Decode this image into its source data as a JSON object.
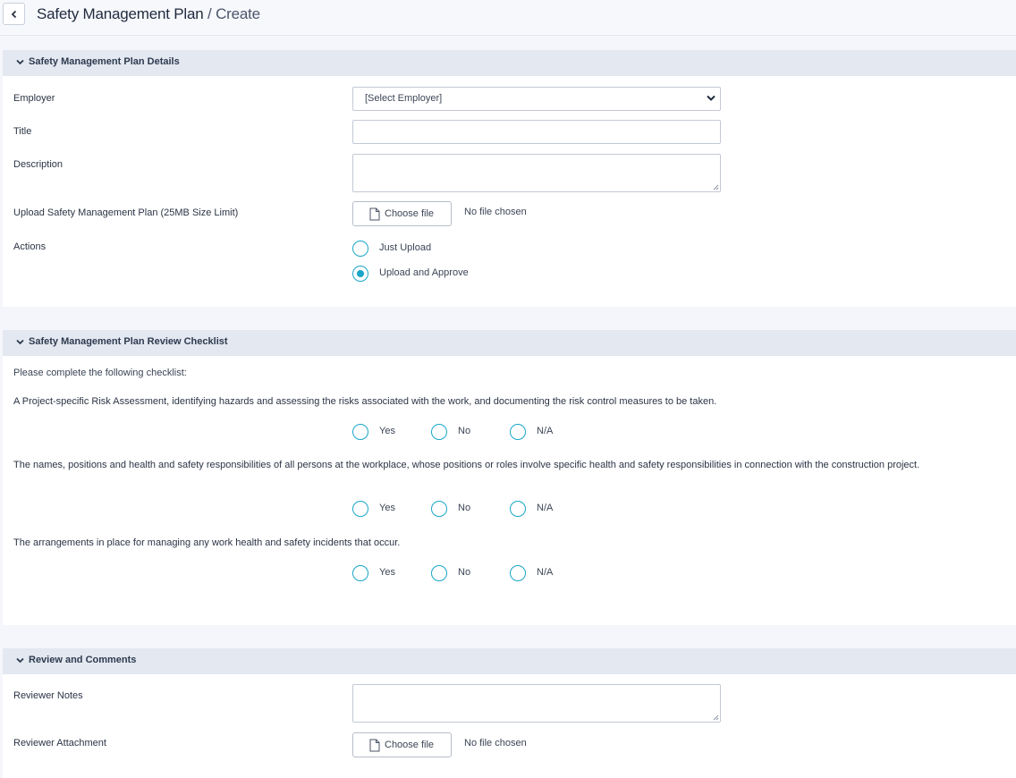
{
  "header": {
    "title": "Safety Management Plan",
    "separator": " / ",
    "current": "Create"
  },
  "details": {
    "title": "Safety Management Plan Details",
    "employer_label": "Employer",
    "employer_value": "[Select Employer]",
    "title_label": "Title",
    "title_value": "",
    "description_label": "Description",
    "description_value": "",
    "upload_label": "Upload Safety Management Plan (25MB Size Limit)",
    "choose_file": "Choose file",
    "no_file": "No file chosen",
    "actions_label": "Actions",
    "actions": [
      {
        "label": "Just Upload",
        "selected": false
      },
      {
        "label": "Upload and Approve",
        "selected": true
      }
    ]
  },
  "checklist": {
    "title": "Safety Management Plan Review Checklist",
    "intro": "Please complete the following checklist:",
    "options": [
      "Yes",
      "No",
      "N/A"
    ],
    "questions": [
      "A Project-specific Risk Assessment, identifying hazards and assessing the risks associated with the work, and documenting the risk control measures to be taken.",
      "The names, positions and health and safety responsibilities of all persons at the workplace, whose positions or roles involve specific health and safety responsibilities in connection with the construction project.",
      "The arrangements in place for managing any work health and safety incidents that occur."
    ]
  },
  "review": {
    "title": "Review and Comments",
    "notes_label": "Reviewer Notes",
    "notes_value": "",
    "attachment_label": "Reviewer Attachment",
    "choose_file": "Choose file",
    "no_file": "No file chosen"
  },
  "colors": {
    "accent": "#1aa6c8",
    "section_header_bg": "#e3e8f1",
    "page_bg": "#f4f6fb"
  },
  "icons": {
    "back": "chevron-left-icon",
    "collapse": "chevron-down-icon",
    "file": "file-icon",
    "select_caret": "chevron-down-icon"
  }
}
